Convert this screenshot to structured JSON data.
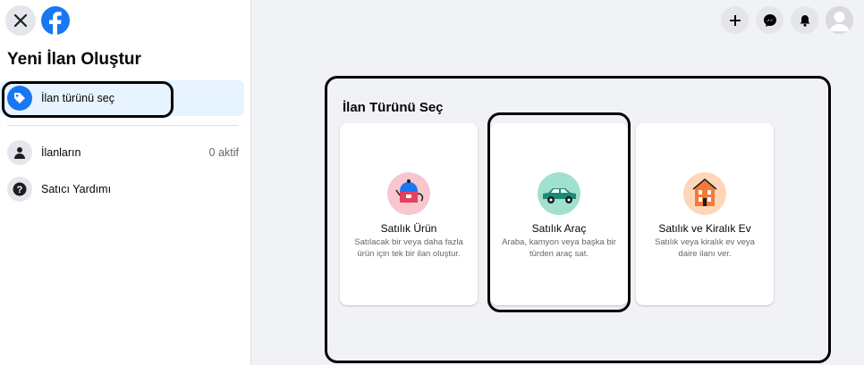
{
  "sidebar": {
    "title": "Yeni İlan Oluştur",
    "items": [
      {
        "label": "İlan türünü seç",
        "icon": "tag-icon"
      },
      {
        "label": "İlanların",
        "meta": "0 aktif",
        "icon": "person-icon"
      },
      {
        "label": "Satıcı Yardımı",
        "icon": "help-icon"
      }
    ]
  },
  "main": {
    "title": "İlan Türünü Seç",
    "cards": [
      {
        "title": "Satılık Ürün",
        "description": "Satılacak bir veya daha fazla ürün için tek bir ilan oluştur.",
        "icon": "kettle-icon"
      },
      {
        "title": "Satılık Araç",
        "description": "Araba, kamyon veya başka bir türden araç sat.",
        "icon": "car-icon"
      },
      {
        "title": "Satılık ve Kiralık Ev",
        "description": "Satılık veya kiralık ev veya daire ilanı ver.",
        "icon": "house-icon"
      }
    ]
  },
  "header_icons": [
    "plus-icon",
    "messenger-icon",
    "bell-icon",
    "avatar"
  ],
  "colors": {
    "brand": "#1877f2",
    "active_bg": "#e7f3ff"
  }
}
